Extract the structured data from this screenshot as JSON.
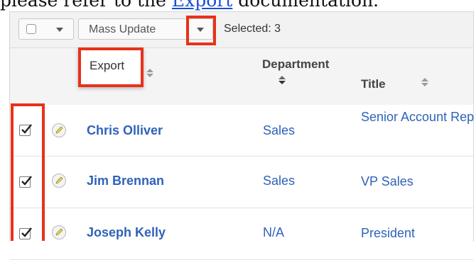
{
  "doc": {
    "text_before": "please refer to the ",
    "link": "Export",
    "text_after": " documentation."
  },
  "toolbar": {
    "mass_update_label": "Mass Update",
    "selected_label": "Selected: 3"
  },
  "dropdown": {
    "export_label": "Export"
  },
  "columns": {
    "department": "Department",
    "title": "Title"
  },
  "rows": [
    {
      "name": "Chris Olliver",
      "department": "Sales",
      "title": "Senior Account Rep",
      "checked": true
    },
    {
      "name": "Jim Brennan",
      "department": "Sales",
      "title": "VP Sales",
      "checked": true
    },
    {
      "name": "Joseph Kelly",
      "department": "N/A",
      "title": "President",
      "checked": true
    }
  ],
  "colors": {
    "highlight": "#e8311a",
    "link": "#2f62b8"
  }
}
